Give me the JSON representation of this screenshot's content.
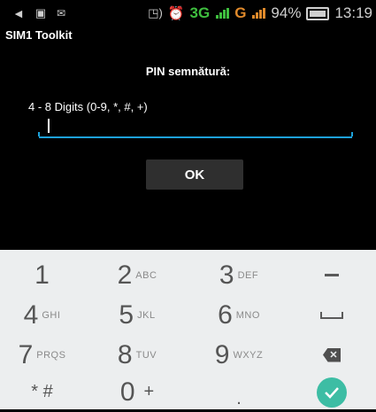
{
  "status_bar": {
    "network1": "3G",
    "network2": "G",
    "battery": "94%",
    "time": "13:19"
  },
  "app": {
    "title": "SIM1 Toolkit",
    "prompt": "PIN semnătură:",
    "hint": "4 - 8 Digits (0-9, *, #, +)",
    "input_value": "",
    "ok_label": "OK"
  },
  "keypad": {
    "keys": [
      {
        "digit": "1",
        "letters": ""
      },
      {
        "digit": "2",
        "letters": "ABC"
      },
      {
        "digit": "3",
        "letters": "DEF"
      },
      {
        "digit": "4",
        "letters": "GHI"
      },
      {
        "digit": "5",
        "letters": "JKL"
      },
      {
        "digit": "6",
        "letters": "MNO"
      },
      {
        "digit": "7",
        "letters": "PRQS"
      },
      {
        "digit": "8",
        "letters": "TUV"
      },
      {
        "digit": "9",
        "letters": "WXYZ"
      },
      {
        "digit": "0",
        "letters": "+"
      }
    ],
    "star_hash": "* #",
    "dot": "."
  },
  "colors": {
    "accent": "#1da1d9",
    "done": "#3dbda4",
    "keypad_bg": "#eceeef"
  }
}
